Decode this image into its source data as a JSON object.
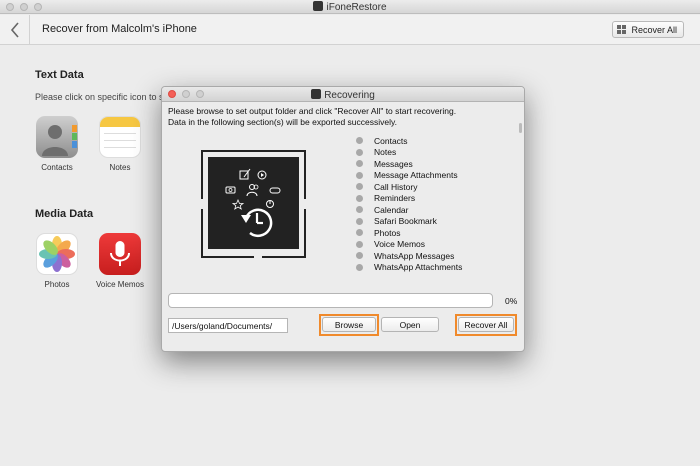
{
  "window": {
    "title": "iFoneRestore"
  },
  "header": {
    "title": "Recover from Malcolm's iPhone",
    "recover_all_label": "Recover All"
  },
  "text_data": {
    "title": "Text Data",
    "hint": "Please click on specific icon to sc",
    "items": [
      {
        "label": "Contacts",
        "icon": "contacts-icon"
      },
      {
        "label": "Notes",
        "icon": "notes-icon"
      }
    ]
  },
  "media_data": {
    "title": "Media Data",
    "items": [
      {
        "label": "Photos",
        "icon": "photos-icon"
      },
      {
        "label": "Voice Memos",
        "icon": "microphone-icon"
      }
    ]
  },
  "dialog": {
    "title": "Recovering",
    "instruction": "Please browse to set output folder and click \"Recover All\" to start recovering.",
    "info": "Data in the following section(s) will be exported successively.",
    "sections": [
      "Contacts",
      "Notes",
      "Messages",
      "Message Attachments",
      "Call History",
      "Reminders",
      "Calendar",
      "Safari Bookmark",
      "Photos",
      "Voice Memos",
      "WhatsApp Messages",
      "WhatsApp Attachments"
    ],
    "progress_percent": 0,
    "progress_label": "0%",
    "output_path": "/Users/goland/Documents/",
    "browse_label": "Browse",
    "open_label": "Open",
    "recover_all_label": "Recover All"
  },
  "colors": {
    "highlight": "#f08a2c",
    "close_button": "#f45f57",
    "list_dot": "#a8a8a8"
  }
}
